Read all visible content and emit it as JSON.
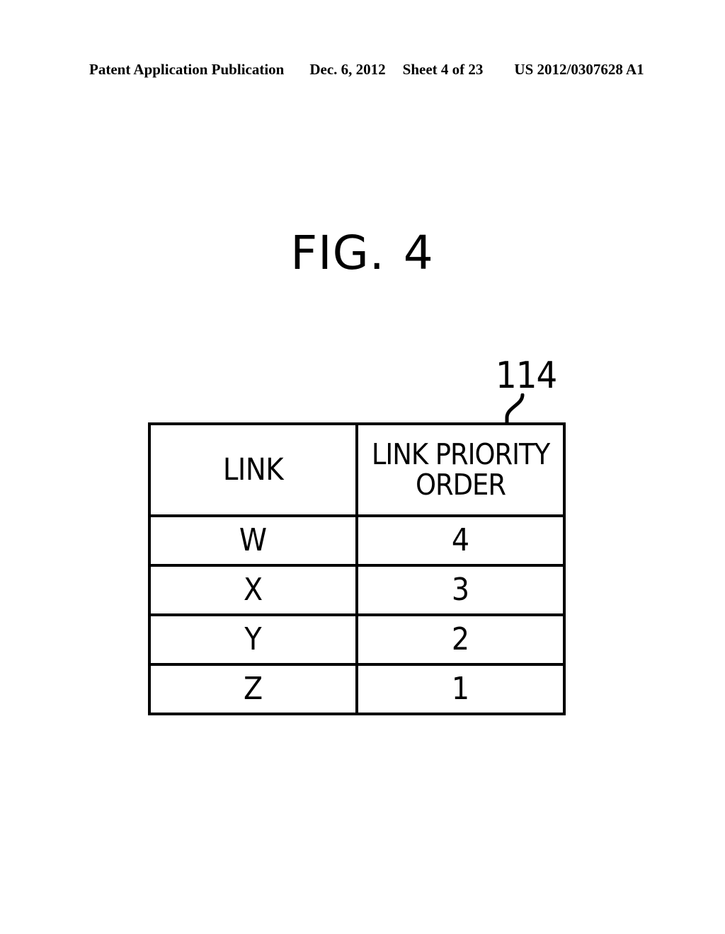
{
  "header": {
    "publication": "Patent Application Publication",
    "date": "Dec. 6, 2012",
    "sheet": "Sheet 4 of 23",
    "document_number": "US 2012/0307628 A1"
  },
  "figure": {
    "label_word": "FIG.",
    "label_number": "4",
    "reference_numeral": "114"
  },
  "table": {
    "columns": [
      {
        "label": "LINK"
      },
      {
        "label_line1": "LINK PRIORITY",
        "label_line2": "ORDER"
      }
    ],
    "rows": [
      {
        "link": "W",
        "priority": "4"
      },
      {
        "link": "X",
        "priority": "3"
      },
      {
        "link": "Y",
        "priority": "2"
      },
      {
        "link": "Z",
        "priority": "1"
      }
    ]
  },
  "colors": {
    "ink": "#000000",
    "paper": "#ffffff"
  }
}
